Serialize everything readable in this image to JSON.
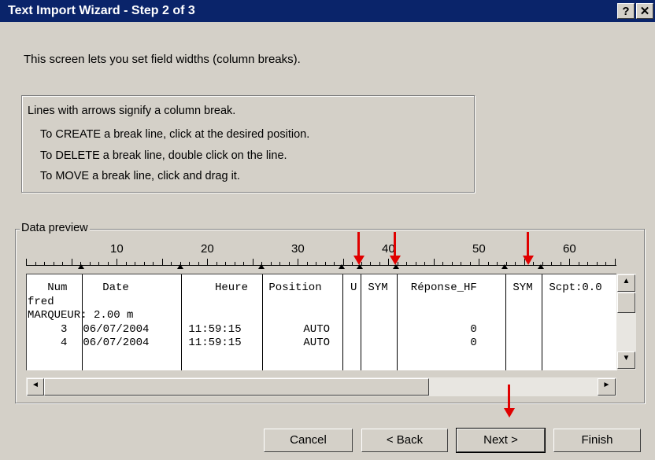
{
  "window": {
    "title": "Text Import Wizard - Step 2 of 3",
    "help_label": "?",
    "close_label": "✕"
  },
  "intro_text": "This screen lets you set field widths (column breaks).",
  "info": {
    "lines": [
      "Lines with arrows signify a column break.",
      "To CREATE a break line, click at the desired position.",
      "To DELETE a break line, double click on the line.",
      "To MOVE a break line, click and drag it."
    ]
  },
  "preview_group": {
    "label": "Data preview",
    "ruler_numbers": [
      "10",
      "20",
      "30",
      "40",
      "50",
      "60"
    ]
  },
  "preview_rows": [
    [
      "   Num",
      "   Date   ",
      "     Heure",
      " Position",
      "U",
      " SYM",
      "  Réponse_HF",
      " SYM",
      " Scpt:0.0"
    ],
    [
      "fred",
      "",
      "",
      "",
      "",
      "",
      "",
      "",
      ""
    ],
    [
      "MARQUEUR: 2.00 m",
      "",
      "",
      "",
      "",
      "",
      "",
      "",
      ""
    ],
    [
      "     3",
      " 06/07/2004",
      " 11:59:15",
      "      AUTO",
      "",
      "",
      "           0",
      "",
      ""
    ],
    [
      "     4",
      " 06/07/2004",
      " 11:59:15",
      "      AUTO",
      "",
      "",
      "           0",
      "",
      ""
    ]
  ],
  "scroll": {
    "up_label": "▲",
    "down_label": "▼",
    "left_label": "◄",
    "right_label": "►"
  },
  "buttons": {
    "cancel": "Cancel",
    "back": "< Back",
    "next": "Next >",
    "finish": "Finish"
  }
}
